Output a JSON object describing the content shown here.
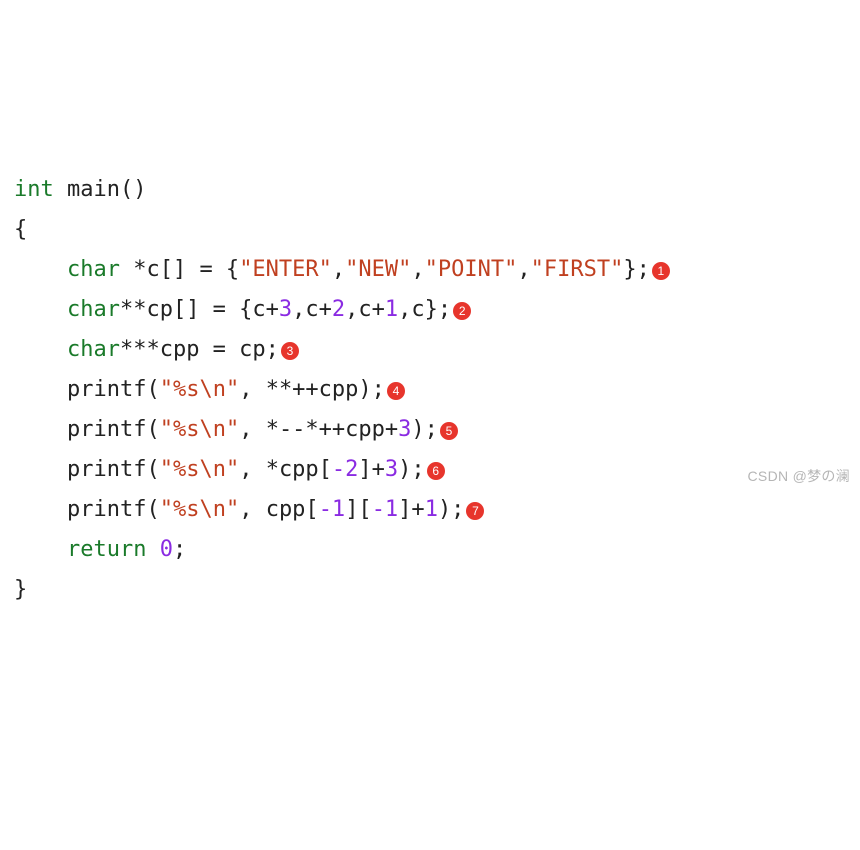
{
  "code": {
    "lines": [
      {
        "indent": 0,
        "segments": [
          {
            "cls": "kw",
            "t": "int"
          },
          {
            "cls": "punct",
            "t": " "
          },
          {
            "cls": "ident",
            "t": "main"
          },
          {
            "cls": "punct",
            "t": "()"
          }
        ],
        "badge": null
      },
      {
        "indent": 0,
        "segments": [
          {
            "cls": "punct",
            "t": "{"
          }
        ],
        "badge": null
      },
      {
        "indent": 1,
        "segments": [
          {
            "cls": "kw",
            "t": "char"
          },
          {
            "cls": "punct",
            "t": " *c[] = {"
          },
          {
            "cls": "str",
            "t": "\"ENTER\""
          },
          {
            "cls": "punct",
            "t": ","
          },
          {
            "cls": "str",
            "t": "\"NEW\""
          },
          {
            "cls": "punct",
            "t": ","
          },
          {
            "cls": "str",
            "t": "\"POINT\""
          },
          {
            "cls": "punct",
            "t": ","
          },
          {
            "cls": "str",
            "t": "\"FIRST\""
          },
          {
            "cls": "punct",
            "t": "};"
          }
        ],
        "badge": "1"
      },
      {
        "indent": 1,
        "segments": [
          {
            "cls": "kw",
            "t": "char"
          },
          {
            "cls": "punct",
            "t": "**cp[] = {c+"
          },
          {
            "cls": "num",
            "t": "3"
          },
          {
            "cls": "punct",
            "t": ",c+"
          },
          {
            "cls": "num",
            "t": "2"
          },
          {
            "cls": "punct",
            "t": ",c+"
          },
          {
            "cls": "num",
            "t": "1"
          },
          {
            "cls": "punct",
            "t": ",c};"
          }
        ],
        "badge": "2"
      },
      {
        "indent": 1,
        "segments": [
          {
            "cls": "kw",
            "t": "char"
          },
          {
            "cls": "punct",
            "t": "***cpp = cp;"
          }
        ],
        "badge": "3"
      },
      {
        "indent": 1,
        "segments": [
          {
            "cls": "ident",
            "t": "printf"
          },
          {
            "cls": "punct",
            "t": "("
          },
          {
            "cls": "str",
            "t": "\"%s\\n\""
          },
          {
            "cls": "punct",
            "t": ", **++cpp);"
          }
        ],
        "badge": "4"
      },
      {
        "indent": 1,
        "segments": [
          {
            "cls": "ident",
            "t": "printf"
          },
          {
            "cls": "punct",
            "t": "("
          },
          {
            "cls": "str",
            "t": "\"%s\\n\""
          },
          {
            "cls": "punct",
            "t": ", *--*++cpp+"
          },
          {
            "cls": "num",
            "t": "3"
          },
          {
            "cls": "punct",
            "t": ");"
          }
        ],
        "badge": "5"
      },
      {
        "indent": 1,
        "segments": [
          {
            "cls": "ident",
            "t": "printf"
          },
          {
            "cls": "punct",
            "t": "("
          },
          {
            "cls": "str",
            "t": "\"%s\\n\""
          },
          {
            "cls": "punct",
            "t": ", *cpp["
          },
          {
            "cls": "num",
            "t": "-2"
          },
          {
            "cls": "punct",
            "t": "]+"
          },
          {
            "cls": "num",
            "t": "3"
          },
          {
            "cls": "punct",
            "t": ");"
          }
        ],
        "badge": "6"
      },
      {
        "indent": 1,
        "segments": [
          {
            "cls": "ident",
            "t": "printf"
          },
          {
            "cls": "punct",
            "t": "("
          },
          {
            "cls": "str",
            "t": "\"%s\\n\""
          },
          {
            "cls": "punct",
            "t": ", cpp["
          },
          {
            "cls": "num",
            "t": "-1"
          },
          {
            "cls": "punct",
            "t": "]["
          },
          {
            "cls": "num",
            "t": "-1"
          },
          {
            "cls": "punct",
            "t": "]+"
          },
          {
            "cls": "num",
            "t": "1"
          },
          {
            "cls": "punct",
            "t": ");"
          }
        ],
        "badge": "7"
      },
      {
        "indent": 1,
        "segments": [
          {
            "cls": "kw",
            "t": "return"
          },
          {
            "cls": "punct",
            "t": " "
          },
          {
            "cls": "num",
            "t": "0"
          },
          {
            "cls": "punct",
            "t": ";"
          }
        ],
        "badge": null
      },
      {
        "indent": 0,
        "segments": [
          {
            "cls": "punct",
            "t": "}"
          }
        ],
        "badge": null
      }
    ]
  },
  "indent_unit": "    ",
  "watermark": "CSDN @梦の澜"
}
